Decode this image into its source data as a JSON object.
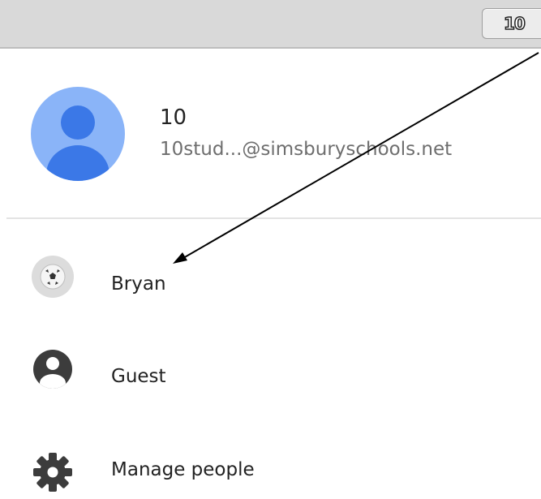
{
  "toolbar": {
    "profile_button_label": "10"
  },
  "account": {
    "name": "10",
    "email": "10stud...@simsburyschools.net"
  },
  "menu": {
    "items": [
      {
        "label": "Bryan",
        "icon": "soccer-ball-avatar-icon"
      },
      {
        "label": "Guest",
        "icon": "guest-person-icon"
      },
      {
        "label": "Manage people",
        "icon": "gear-icon"
      }
    ]
  },
  "colors": {
    "avatar_background": "#8ab4f8",
    "avatar_figure": "#3b78e7",
    "icon_dark": "#3c3c3c",
    "annotation_arrow": "#000000"
  }
}
